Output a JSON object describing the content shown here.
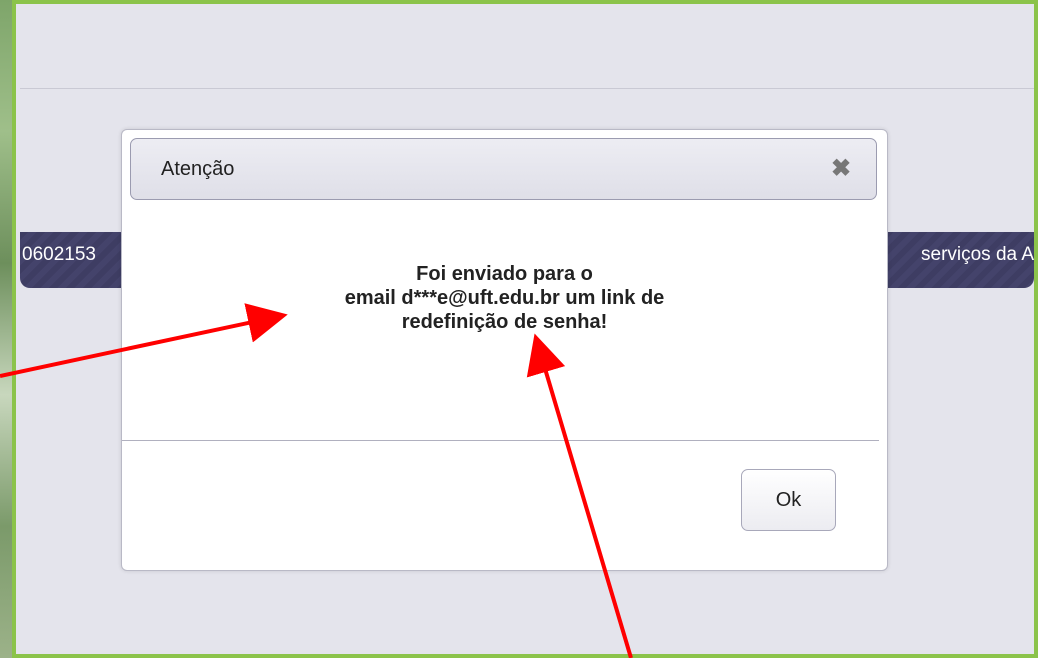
{
  "background": {
    "navbar_left_text": "0602153",
    "navbar_right_text": "serviços da A"
  },
  "dialog": {
    "title": "Atenção",
    "close_glyph": "✖",
    "message_lines": [
      "Foi enviado para o",
      "email d***e@uft.edu.br um link de",
      "redefinição de senha!"
    ],
    "ok_label": "Ok"
  },
  "colors": {
    "frame_border": "#8bc34a",
    "navbar": "#3e3d63",
    "annotation_arrow": "#ff0000"
  }
}
